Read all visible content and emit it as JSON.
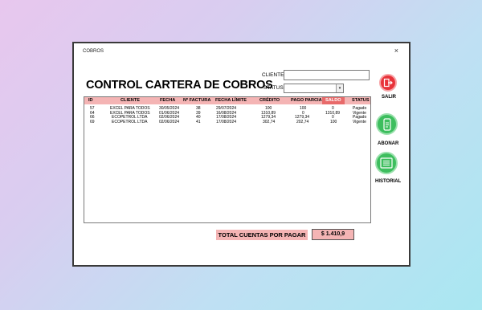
{
  "window": {
    "title": "COBROS",
    "close_glyph": "×"
  },
  "form": {
    "title": "CONTROL CARTERA DE COBROS"
  },
  "filters": {
    "cliente_label": "CLIENTE:",
    "cliente_value": "",
    "status_label": "STATUS:",
    "status_value": "",
    "status_arrow": "▾"
  },
  "table": {
    "headers": [
      "ID",
      "CLIENTE",
      "FECHA",
      "Nº FACTURA",
      "FECHA LÍMITE",
      "CRÉDITO",
      "PAGO PARCIAL",
      "SALDO",
      "STATUS"
    ],
    "rows": [
      [
        "57",
        "EXCEL PARA TODOS",
        "30/05/2024",
        "38",
        "29/07/2024",
        "100",
        "100",
        "0",
        "Pagado"
      ],
      [
        "64",
        "EXCEL PARA TODOS",
        "01/06/2024",
        "39",
        "16/08/2024",
        "1310,89",
        "0",
        "1310,89",
        "Vigente"
      ],
      [
        "66",
        "ECOPETROL LTDA",
        "02/06/2024",
        "40",
        "17/08/2024",
        "1279,34",
        "1279,34",
        "0",
        "Pagado"
      ],
      [
        "69",
        "ECOPETROL LTDA",
        "02/06/2024",
        "41",
        "17/08/2024",
        "302,74",
        "202,74",
        "100",
        "Vigente"
      ]
    ]
  },
  "actions": {
    "salir": {
      "label": "SALIR",
      "icon": "exit-door-icon",
      "color": "#e8333a"
    },
    "abonar": {
      "label": "ABONAR",
      "icon": "phone-payment-icon",
      "color": "#3dbe5e"
    },
    "historial": {
      "label": "HISTORIAL",
      "icon": "list-history-icon",
      "color": "#3dbe5e"
    }
  },
  "totals": {
    "label": "TOTAL CUENTAS POR PAGAR",
    "value": "$ 1.410,9"
  },
  "colors": {
    "header_bg": "#f4b4b4",
    "saldo_header": "#e86a6a"
  }
}
